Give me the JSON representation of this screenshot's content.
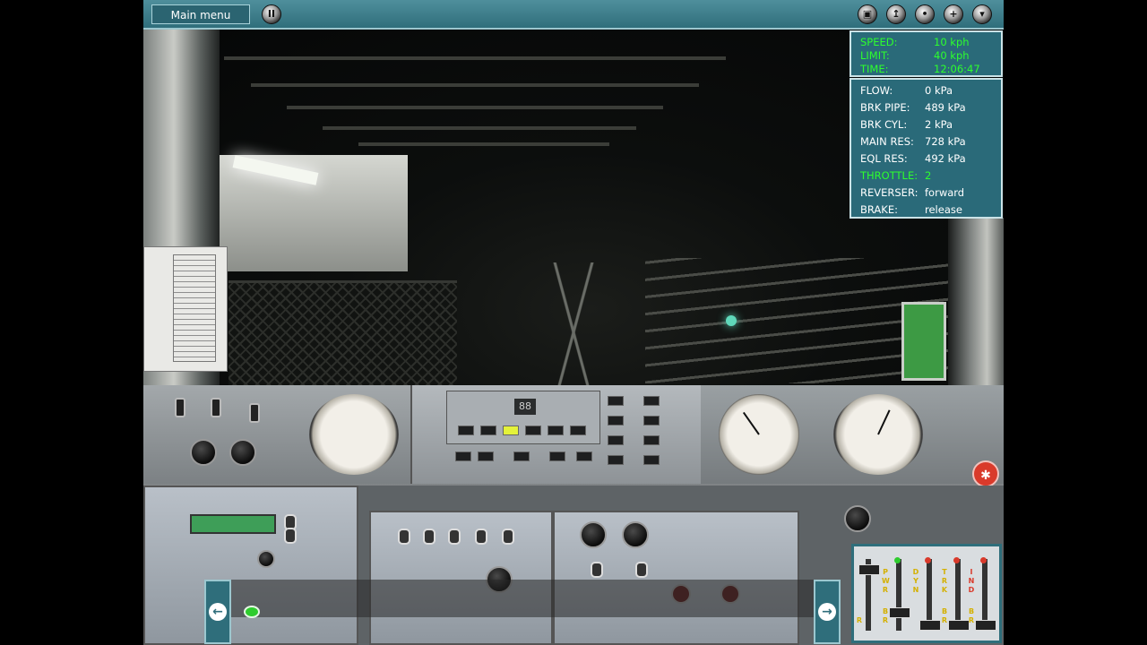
{
  "topbar": {
    "main_menu_label": "Main menu",
    "icons": [
      "pause-icon",
      "cabview-icon",
      "camera-icon",
      "sphere-icon",
      "zoom-in-icon",
      "zoom-out-icon"
    ]
  },
  "hud_top": {
    "rows": [
      {
        "key": "SPEED:",
        "value": "10 kph"
      },
      {
        "key": "LIMIT:",
        "value": "40 kph"
      },
      {
        "key": "TIME:",
        "value": "12:06:47"
      }
    ]
  },
  "hud_main": {
    "rows": [
      {
        "key": "FLOW:",
        "value": "0 kPa",
        "highlight": false
      },
      {
        "key": "BRK PIPE:",
        "value": "489 kPa",
        "highlight": false
      },
      {
        "key": "BRK CYL:",
        "value": "2 kPa",
        "highlight": false
      },
      {
        "key": "MAIN RES:",
        "value": "728 kPa",
        "highlight": false
      },
      {
        "key": "EQL RES:",
        "value": "492 kPa",
        "highlight": false
      },
      {
        "key": "THROTTLE:",
        "value": "2",
        "highlight": true
      },
      {
        "key": "REVERSER:",
        "value": "forward",
        "highlight": false
      },
      {
        "key": "BRAKE:",
        "value": "release",
        "highlight": false
      }
    ]
  },
  "sliders": {
    "labels": [
      "PWR",
      "DYN",
      "TRK",
      "IND"
    ],
    "bottom_labels": [
      "R",
      "BR",
      "BR",
      "BR"
    ]
  },
  "colors": {
    "hud_bg": "#2c7080",
    "hud_green": "#2dff2d",
    "topbar": "#3d7f8c",
    "signal": "#5fd8ba"
  }
}
